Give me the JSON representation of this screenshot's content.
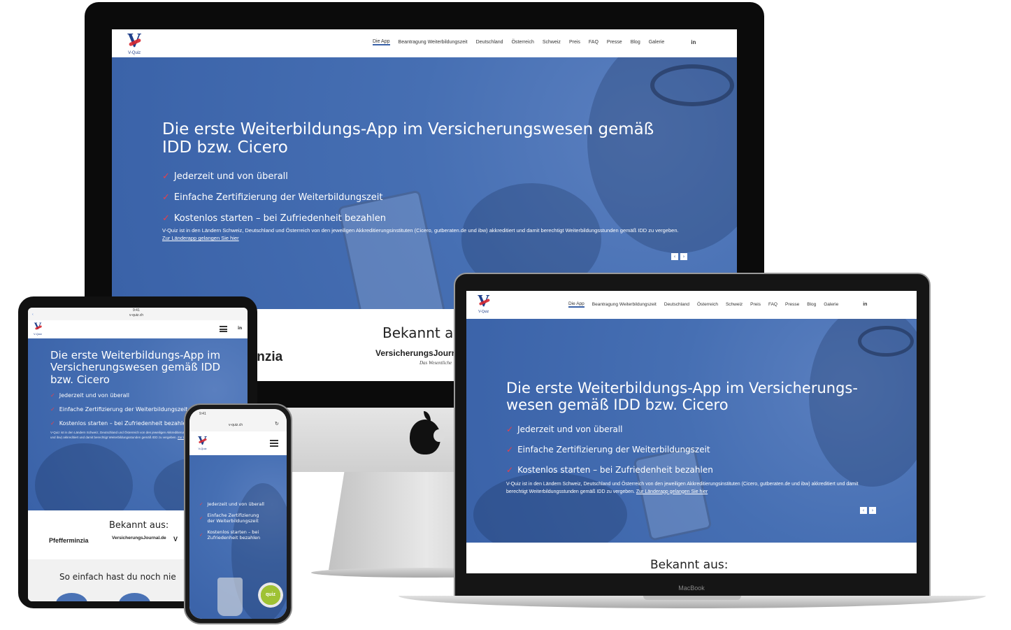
{
  "site": {
    "logo_letter": "V",
    "logo_sub": "V-Quiz",
    "nav": [
      "Die App",
      "Beantragung Weiterbildungszeit",
      "Deutschland",
      "Österreich",
      "Schweiz",
      "Preis",
      "FAQ",
      "Presse",
      "Blog",
      "Galerie"
    ],
    "social": "in",
    "hero_title_imac": "Die erste Weiterbildungs-App im Versicherungswesen gemäß IDD bzw. Cicero",
    "hero_title_laptop": "Die erste Weiterbildungs-App im Versicherungs-wesen gemäß IDD bzw. Cicero",
    "hero_title_tablet": "Die erste Weiterbildungs-App im Versicherungswesen gemäß IDD bzw. Cicero",
    "features": [
      "Jederzeit und von überall",
      "Einfache Zertifizierung der Weiterbildungszeit",
      "Kostenlos starten – bei Zufriedenheit bezahlen"
    ],
    "phone_features": [
      "Jederzeit und von überall",
      "Einfache Zertifizierung der Weiterbildungszeit",
      "Kostenlos starten – bei Zufriedenheit bezahlen"
    ],
    "description": "V-Quiz ist in den Ländern Schweiz, Deutschland und Österreich von den jeweiligen Akkreditierungsinstituten (Cicero, gutberaten.de und ibw) akkreditiert und damit berechtigt Weiterbildungsstunden gemäß IDD zu vergeben.",
    "description_link": "Zur Länderapp gelangen Sie hier",
    "slider_prev": "‹",
    "slider_next": "›",
    "known_from": "Bekannt aus:",
    "known_from_imac": "Bekannt au",
    "press_logos": [
      "Pfefferminzia",
      "VersicherungsJournal.de",
      "V"
    ],
    "press_imac_left": "inzia",
    "press_imac_right": "VersicherungsJourn",
    "press_imac_right_sub": "Das Wesentliche",
    "steps_title": "So einfach hast du noch nie"
  },
  "browser": {
    "tablet_url": "v-quiz.ch",
    "phone_url": "v-quiz.ch",
    "tablet_time": "9:41",
    "phone_time": "9:41"
  },
  "devices": {
    "laptop_brand": "MacBook"
  },
  "badge": {
    "text": "quiz"
  },
  "colors": {
    "hero_blue": "#466fb3",
    "check_red": "#e8404a",
    "logo_blue": "#1f3f8a",
    "logo_red": "#d7262e"
  }
}
